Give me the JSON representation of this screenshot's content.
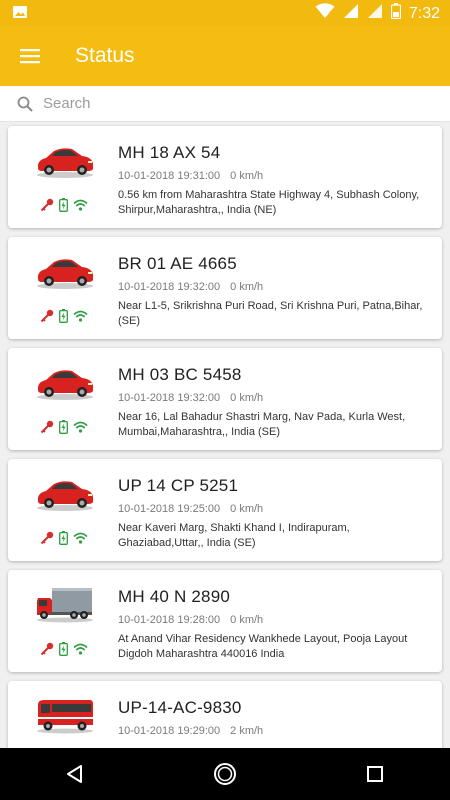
{
  "status_bar": {
    "time": "7:32"
  },
  "app_bar": {
    "title": "Status"
  },
  "search": {
    "placeholder": "Search"
  },
  "colors": {
    "accent": "#f5bd12",
    "ignition": "#d32f2f",
    "ok": "#2e9e3e"
  },
  "vehicles": [
    {
      "plate": "MH 18 AX 54",
      "datetime": "10-01-2018 19:31:00",
      "speed": "0 km/h",
      "address": "0.56 km from Maharashtra State Highway 4, Subhash Colony, Shirpur,Maharashtra,, India (NE)",
      "type": "car-icon"
    },
    {
      "plate": "BR 01 AE 4665",
      "datetime": "10-01-2018 19:32:00",
      "speed": "0 km/h",
      "address": "Near L1-5, Srikrishna Puri Road, Sri Krishna Puri, Patna,Bihar,(SE)",
      "type": "car-icon"
    },
    {
      "plate": "MH 03 BC 5458",
      "datetime": "10-01-2018 19:32:00",
      "speed": "0 km/h",
      "address": "Near 16,  Lal Bahadur Shastri Marg,  Nav Pada,  Kurla West, Mumbai,Maharashtra,, India (SE)",
      "type": "car-icon"
    },
    {
      "plate": "UP 14 CP 5251",
      "datetime": "10-01-2018 19:25:00",
      "speed": "0 km/h",
      "address": "Near Kaveri Marg, Shakti Khand I, Indirapuram, Ghaziabad,Uttar,, India (SE)",
      "type": "car-icon"
    },
    {
      "plate": "MH 40 N 2890",
      "datetime": "10-01-2018 19:28:00",
      "speed": "0 km/h",
      "address": "At  Anand Vihar Residency Wankhede Layout, Pooja Layout Digdoh Maharashtra 440016 India",
      "type": "truck-icon"
    },
    {
      "plate": "UP-14-AC-9830",
      "datetime": "10-01-2018 19:29:00",
      "speed": "2 km/h",
      "address": "",
      "type": "bus-icon"
    }
  ]
}
